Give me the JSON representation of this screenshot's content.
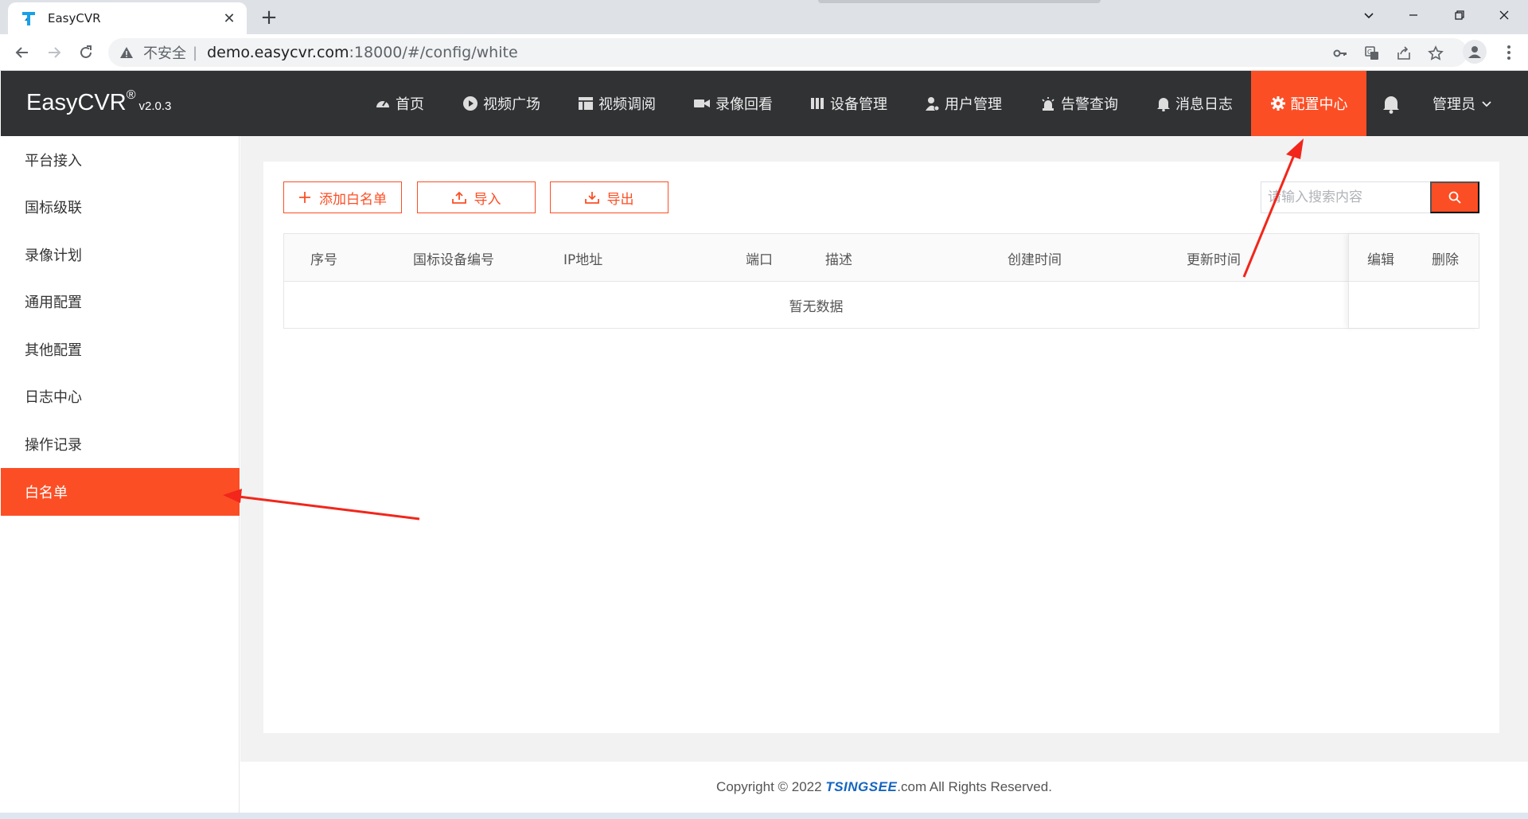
{
  "browser": {
    "tab_title": "EasyCVR",
    "insecure_label": "不安全",
    "separator": "|",
    "url_host": "demo.easycvr.com",
    "url_rest": ":18000/#/config/white"
  },
  "app": {
    "brand_name": "EasyCVR",
    "brand_reg": "®",
    "brand_version": "v2.0.3",
    "nav": [
      {
        "label": "首页",
        "icon": "dashboard-icon"
      },
      {
        "label": "视频广场",
        "icon": "play-circle-icon"
      },
      {
        "label": "视频调阅",
        "icon": "layout-icon"
      },
      {
        "label": "录像回看",
        "icon": "video-camera-icon"
      },
      {
        "label": "设备管理",
        "icon": "device-icon"
      },
      {
        "label": "用户管理",
        "icon": "user-gear-icon"
      },
      {
        "label": "告警查询",
        "icon": "alarm-light-icon"
      },
      {
        "label": "消息日志",
        "icon": "bell-icon"
      },
      {
        "label": "配置中心",
        "icon": "gear-icon"
      }
    ],
    "user_label": "管理员",
    "accent_color": "#fc4e25",
    "header_color": "#303234"
  },
  "sidebar": {
    "items": [
      "平台接入",
      "国标级联",
      "录像计划",
      "通用配置",
      "其他配置",
      "日志中心",
      "操作记录",
      "白名单"
    ],
    "active_index": 7
  },
  "toolbar": {
    "add_label": "添加白名单",
    "import_label": "导入",
    "export_label": "导出",
    "search_placeholder": "请输入搜索内容"
  },
  "table": {
    "columns": [
      "序号",
      "国标设备编号",
      "IP地址",
      "端口",
      "描述",
      "创建时间",
      "更新时间",
      "编辑",
      "删除"
    ],
    "empty_text": "暂无数据"
  },
  "footer": {
    "prefix": "Copyright © 2022 ",
    "brand": "TSINGSEE",
    "suffix": ".com All Rights Reserved."
  }
}
